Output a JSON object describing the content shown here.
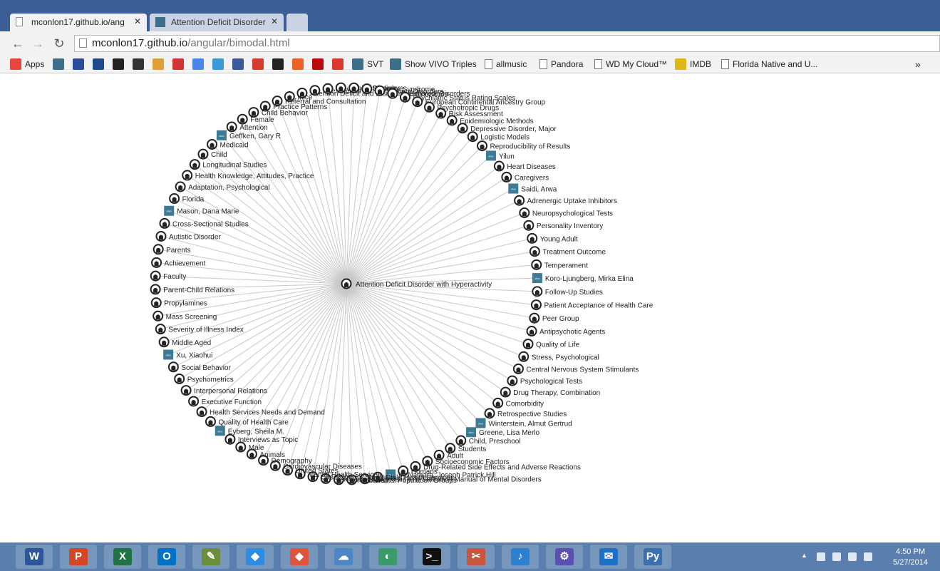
{
  "tabs": [
    {
      "title": "mconlon17.github.io/ang",
      "active": true
    },
    {
      "title": "Attention Deficit Disorder",
      "active": false
    }
  ],
  "omnibox": {
    "host": "mconlon17.github.io",
    "path": "/angular/bimodal.html"
  },
  "bookmarks": [
    {
      "label": "Apps",
      "icon": "apps-grid-icon",
      "color": "#e8453c"
    },
    {
      "label": "",
      "icon": "vivo-icon",
      "color": "#3d6f8a"
    },
    {
      "label": "",
      "icon": "uf-icon",
      "color": "#2a4d9b"
    },
    {
      "label": "",
      "icon": "twc-icon",
      "color": "#1d4a8c"
    },
    {
      "label": "",
      "icon": "github-icon",
      "color": "#222222"
    },
    {
      "label": "",
      "icon": "diamond-icon",
      "color": "#333333"
    },
    {
      "label": "",
      "icon": "checklist-icon",
      "color": "#e0a030"
    },
    {
      "label": "",
      "icon": "arc-icon",
      "color": "#d33333"
    },
    {
      "label": "",
      "icon": "google-icon",
      "color": "#4a86e8"
    },
    {
      "label": "",
      "icon": "twitter-icon",
      "color": "#3a9ad9"
    },
    {
      "label": "",
      "icon": "facebook-icon",
      "color": "#3b5998"
    },
    {
      "label": "",
      "icon": "e-icon",
      "color": "#d63a2a"
    },
    {
      "label": "",
      "icon": "amazon-icon",
      "color": "#222222"
    },
    {
      "label": "",
      "icon": "bitly-icon",
      "color": "#ee6123"
    },
    {
      "label": "",
      "icon": "netflix-icon",
      "color": "#b9090b"
    },
    {
      "label": "",
      "icon": "tomato-icon",
      "color": "#d9382b"
    },
    {
      "label": "SVT",
      "icon": "vivo-icon",
      "color": "#3d6f8a"
    },
    {
      "label": "Show VIVO Triples",
      "icon": "vivo-icon",
      "color": "#3d6f8a"
    },
    {
      "label": "allmusic",
      "icon": "folder-page-icon",
      "color": "#777777"
    },
    {
      "label": "Pandora",
      "icon": "folder-page-icon",
      "color": "#777777"
    },
    {
      "label": "WD My Cloud™",
      "icon": "folder-page-icon",
      "color": "#777777"
    },
    {
      "label": "IMDB",
      "icon": "imdb-icon",
      "color": "#e2b616"
    },
    {
      "label": "Florida Native and U...",
      "icon": "folder-page-icon",
      "color": "#777777"
    }
  ],
  "overflow_label": "»",
  "graph": {
    "center": "Attention Deficit Disorder with Hyperactivity",
    "nodes": [
      {
        "label": "Reproducibility of Results",
        "kind": "github"
      },
      {
        "label": "Yilun",
        "kind": "vivo"
      },
      {
        "label": "Heart Diseases",
        "kind": "github"
      },
      {
        "label": "Caregivers",
        "kind": "github"
      },
      {
        "label": "Saidi, Arwa",
        "kind": "vivo"
      },
      {
        "label": "Adrenergic Uptake Inhibitors",
        "kind": "github"
      },
      {
        "label": "Neuropsychological Tests",
        "kind": "github"
      },
      {
        "label": "Personality Inventory",
        "kind": "github"
      },
      {
        "label": "Young Adult",
        "kind": "github"
      },
      {
        "label": "Treatment Outcome",
        "kind": "github"
      },
      {
        "label": "Temperament",
        "kind": "github"
      },
      {
        "label": "Koro-Ljungberg, Mirka Elina",
        "kind": "vivo"
      },
      {
        "label": "Follow-Up Studies",
        "kind": "github"
      },
      {
        "label": "Patient Acceptance of Health Care",
        "kind": "github"
      },
      {
        "label": "Peer Group",
        "kind": "github"
      },
      {
        "label": "Antipsychotic Agents",
        "kind": "github"
      },
      {
        "label": "Quality of Life",
        "kind": "github"
      },
      {
        "label": "Stress, Psychological",
        "kind": "github"
      },
      {
        "label": "Central Nervous System Stimulants",
        "kind": "github"
      },
      {
        "label": "Psychological Tests",
        "kind": "github"
      },
      {
        "label": "Drug Therapy, Combination",
        "kind": "github"
      },
      {
        "label": "Comorbidity",
        "kind": "github"
      },
      {
        "label": "Retrospective Studies",
        "kind": "github"
      },
      {
        "label": "Winterstein, Almut Gertrud",
        "kind": "vivo"
      },
      {
        "label": "Greene, Lisa Merlo",
        "kind": "vivo"
      },
      {
        "label": "Child, Preschool",
        "kind": "github"
      },
      {
        "label": "Students",
        "kind": "github"
      },
      {
        "label": "Adult",
        "kind": "github"
      },
      {
        "label": "Socioeconomic Factors",
        "kind": "github"
      },
      {
        "label": "Drug-Related Side Effects and Adverse Reactions",
        "kind": "github"
      },
      {
        "label": "Humans",
        "kind": "github"
      },
      {
        "label": "McNamara, Joseph Patrick Hill",
        "kind": "vivo"
      },
      {
        "label": "Child Health Services",
        "kind": "github"
      },
      {
        "label": "Diagnostic and Statistical Manual of Mental Disorders",
        "kind": "github"
      },
      {
        "label": "Continental Population Groups",
        "kind": "github"
      },
      {
        "label": "Sex Factors",
        "kind": "github"
      },
      {
        "label": "Risk Factors",
        "kind": "github"
      },
      {
        "label": "Case-Control Studies",
        "kind": "github"
      },
      {
        "label": "Mental Health Services",
        "kind": "github"
      },
      {
        "label": "United States",
        "kind": "github"
      },
      {
        "label": "Cardiovascular Diseases",
        "kind": "github"
      },
      {
        "label": "Demography",
        "kind": "github"
      },
      {
        "label": "Animals",
        "kind": "github"
      },
      {
        "label": "Male",
        "kind": "github"
      },
      {
        "label": "Interviews as Topic",
        "kind": "github"
      },
      {
        "label": "Eyberg, Sheila M.",
        "kind": "vivo"
      },
      {
        "label": "Quality of Health Care",
        "kind": "github"
      },
      {
        "label": "Health Services Needs and Demand",
        "kind": "github"
      },
      {
        "label": "Executive Function",
        "kind": "github"
      },
      {
        "label": "Interpersonal Relations",
        "kind": "github"
      },
      {
        "label": "Psychometrics",
        "kind": "github"
      },
      {
        "label": "Social Behavior",
        "kind": "github"
      },
      {
        "label": "Xu, Xiaohui",
        "kind": "vivo"
      },
      {
        "label": "Middle Aged",
        "kind": "github"
      },
      {
        "label": "Severity of Illness Index",
        "kind": "github"
      },
      {
        "label": "Mass Screening",
        "kind": "github"
      },
      {
        "label": "Propylamines",
        "kind": "github"
      },
      {
        "label": "Parent-Child Relations",
        "kind": "github"
      },
      {
        "label": "Faculty",
        "kind": "github"
      },
      {
        "label": "Achievement",
        "kind": "github"
      },
      {
        "label": "Parents",
        "kind": "github"
      },
      {
        "label": "Autistic Disorder",
        "kind": "github"
      },
      {
        "label": "Cross-Sectional Studies",
        "kind": "github"
      },
      {
        "label": "Mason, Dana Marie",
        "kind": "vivo"
      },
      {
        "label": "Florida",
        "kind": "github"
      },
      {
        "label": "Adaptation, Psychological",
        "kind": "github"
      },
      {
        "label": "Health Knowledge, Attitudes, Practice",
        "kind": "github"
      },
      {
        "label": "Longitudinal Studies",
        "kind": "github"
      },
      {
        "label": "Child",
        "kind": "github"
      },
      {
        "label": "Medicaid",
        "kind": "github"
      },
      {
        "label": "Geffken, Gary R",
        "kind": "vivo"
      },
      {
        "label": "Attention",
        "kind": "github"
      },
      {
        "label": "Female",
        "kind": "github"
      },
      {
        "label": "Child Behavior",
        "kind": "github"
      },
      {
        "label": "Practice Patterns",
        "kind": "github"
      },
      {
        "label": "Referral and Consultation",
        "kind": "github"
      },
      {
        "label": "Mice",
        "kind": "github"
      },
      {
        "label": "Attention Deficit and Disruptive Behavior Disorders",
        "kind": "github"
      },
      {
        "label": "Age Factors",
        "kind": "github"
      },
      {
        "label": "Prevalence",
        "kind": "github"
      },
      {
        "label": "Cohort Studies",
        "kind": "github"
      },
      {
        "label": "Tic Disorders",
        "kind": "github"
      },
      {
        "label": "Tourette Syndrome",
        "kind": "github"
      },
      {
        "label": "Anxiety Disorders",
        "kind": "github"
      },
      {
        "label": "Questionnaires",
        "kind": "github"
      },
      {
        "label": "Psychiatric Status Rating Scales",
        "kind": "github"
      },
      {
        "label": "European Continental Ancestry Group",
        "kind": "github"
      },
      {
        "label": "Psychotropic Drugs",
        "kind": "github"
      },
      {
        "label": "Risk Assessment",
        "kind": "github"
      },
      {
        "label": "Epidemiologic Methods",
        "kind": "github"
      },
      {
        "label": "Depressive Disorder, Major",
        "kind": "github"
      },
      {
        "label": "Logistic Models",
        "kind": "github"
      }
    ]
  },
  "taskbar": [
    {
      "app": "word-icon",
      "color": "#2b579a",
      "glyph": "W"
    },
    {
      "app": "powerpoint-icon",
      "color": "#d24726",
      "glyph": "P"
    },
    {
      "app": "excel-icon",
      "color": "#217346",
      "glyph": "X"
    },
    {
      "app": "outlook-icon",
      "color": "#0072c6",
      "glyph": "O"
    },
    {
      "app": "notepad-chart-icon",
      "color": "#6a8e3a",
      "glyph": "✎"
    },
    {
      "app": "dropbox-icon",
      "color": "#2d8de2",
      "glyph": "◆"
    },
    {
      "app": "git-icon",
      "color": "#e0533d",
      "glyph": "◆"
    },
    {
      "app": "onedrive-icon",
      "color": "#4c86c6",
      "glyph": "☁"
    },
    {
      "app": "globe-icon",
      "color": "#3a9a6a",
      "glyph": "◐"
    },
    {
      "app": "terminal-icon",
      "color": "#111111",
      "glyph": ">_"
    },
    {
      "app": "snipping-tool-icon",
      "color": "#c8553d",
      "glyph": "✂"
    },
    {
      "app": "itunes-icon",
      "color": "#2d7fd0",
      "glyph": "♪"
    },
    {
      "app": "settings-gear-icon",
      "color": "#5b4fb0",
      "glyph": "⚙"
    },
    {
      "app": "mail-icon",
      "color": "#1e6fc6",
      "glyph": "✉"
    },
    {
      "app": "python-icon",
      "color": "#3a6fb0",
      "glyph": "Py"
    }
  ],
  "clock": {
    "time": "4:50 PM",
    "date": "5/27/2014"
  }
}
